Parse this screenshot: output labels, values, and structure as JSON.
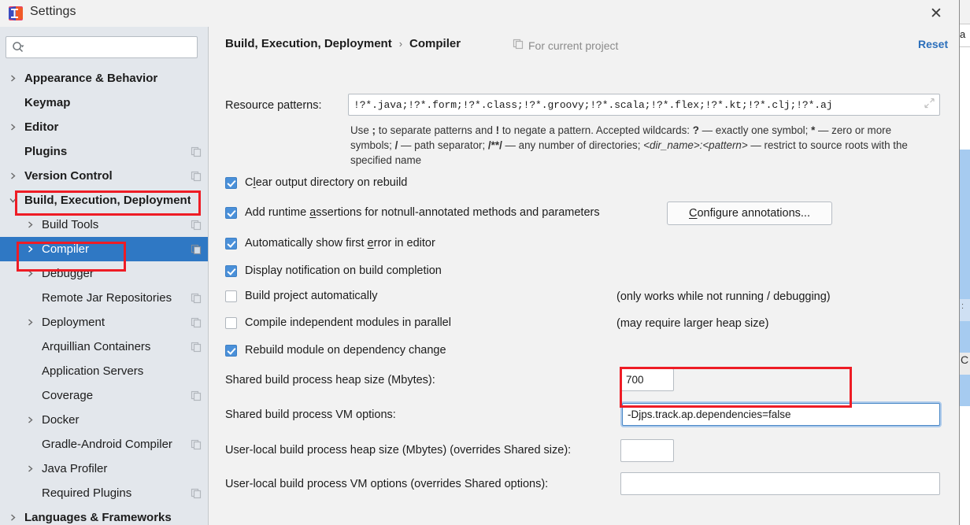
{
  "window": {
    "title": "Settings",
    "app_icon": "intellij-idea-icon",
    "close_label": "✕"
  },
  "sidebar": {
    "search": {
      "placeholder": "",
      "value": "",
      "icon": "search-icon",
      "dropdown_icon": "chevron-down-icon"
    },
    "items": [
      {
        "label": "Appearance & Behavior",
        "level": 0,
        "arrow": "collapsed",
        "copy": false,
        "selected": false
      },
      {
        "label": "Keymap",
        "level": 0,
        "arrow": "none",
        "copy": false,
        "selected": false
      },
      {
        "label": "Editor",
        "level": 0,
        "arrow": "collapsed",
        "copy": false,
        "selected": false
      },
      {
        "label": "Plugins",
        "level": 0,
        "arrow": "none",
        "copy": true,
        "selected": false
      },
      {
        "label": "Version Control",
        "level": 0,
        "arrow": "collapsed",
        "copy": true,
        "selected": false
      },
      {
        "label": "Build, Execution, Deployment",
        "level": 0,
        "arrow": "expanded",
        "copy": false,
        "selected": false
      },
      {
        "label": "Build Tools",
        "level": 1,
        "arrow": "collapsed",
        "copy": true,
        "selected": false
      },
      {
        "label": "Compiler",
        "level": 1,
        "arrow": "collapsed",
        "copy": true,
        "selected": true
      },
      {
        "label": "Debugger",
        "level": 1,
        "arrow": "collapsed",
        "copy": false,
        "selected": false
      },
      {
        "label": "Remote Jar Repositories",
        "level": 1,
        "arrow": "none",
        "copy": true,
        "selected": false
      },
      {
        "label": "Deployment",
        "level": 1,
        "arrow": "collapsed",
        "copy": true,
        "selected": false
      },
      {
        "label": "Arquillian Containers",
        "level": 1,
        "arrow": "none",
        "copy": true,
        "selected": false
      },
      {
        "label": "Application Servers",
        "level": 1,
        "arrow": "none",
        "copy": false,
        "selected": false
      },
      {
        "label": "Coverage",
        "level": 1,
        "arrow": "none",
        "copy": true,
        "selected": false
      },
      {
        "label": "Docker",
        "level": 1,
        "arrow": "collapsed",
        "copy": false,
        "selected": false
      },
      {
        "label": "Gradle-Android Compiler",
        "level": 1,
        "arrow": "none",
        "copy": true,
        "selected": false
      },
      {
        "label": "Java Profiler",
        "level": 1,
        "arrow": "collapsed",
        "copy": false,
        "selected": false
      },
      {
        "label": "Required Plugins",
        "level": 1,
        "arrow": "none",
        "copy": true,
        "selected": false
      },
      {
        "label": "Languages & Frameworks",
        "level": 0,
        "arrow": "collapsed",
        "copy": false,
        "selected": false
      }
    ]
  },
  "header": {
    "breadcrumb_parent": "Build, Execution, Deployment",
    "breadcrumb_separator": "›",
    "breadcrumb_current": "Compiler",
    "for_current_project": "For current project",
    "for_current_project_icon": "copy-project-icon",
    "reset_label": "Reset"
  },
  "form": {
    "resource_patterns_label": "Resource patterns:",
    "resource_patterns_value": "!?*.java;!?*.form;!?*.class;!?*.groovy;!?*.scala;!?*.flex;!?*.kt;!?*.clj;!?*.aj",
    "resource_patterns_expand_icon": "expand-arrows-icon",
    "help_text": {
      "p1": "Use ",
      "b1": ";",
      "p2": " to separate patterns and ",
      "b2": "!",
      "p3": " to negate a pattern. Accepted wildcards: ",
      "b3": "?",
      "p4": " — exactly one symbol; ",
      "b4": "*",
      "p5": " — zero or more symbols; ",
      "b5": "/",
      "p6": " — path separator; ",
      "b6": "/**/",
      "p7": " — any number of directories; ",
      "i1": "<dir_name>:<pattern>",
      "p8": " — restrict to source roots with the specified name"
    },
    "checkboxes": [
      {
        "id": "clear-output-directory-on-rebuild",
        "pre": "C",
        "mn": "l",
        "post": "ear output directory on rebuild",
        "checked": true,
        "note": ""
      },
      {
        "id": "add-runtime-assertions",
        "pre": "Add runtime ",
        "mn": "a",
        "post": "ssertions for notnull-annotated methods and parameters",
        "checked": true,
        "note": ""
      },
      {
        "id": "automatically-show-first-error",
        "pre": "Automatically show first ",
        "mn": "e",
        "post": "rror in editor",
        "checked": true,
        "note": ""
      },
      {
        "id": "display-notification-on-build-completion",
        "pre": "Display notification on build completion",
        "mn": "",
        "post": "",
        "checked": true,
        "note": ""
      },
      {
        "id": "build-project-automatically",
        "pre": "Build project automatically",
        "mn": "",
        "post": "",
        "checked": false,
        "note": "(only works while not running / debugging)"
      },
      {
        "id": "compile-independent-modules-in-parallel",
        "pre": "Compile independent modules in parallel",
        "mn": "",
        "post": "",
        "checked": false,
        "note": "(may require larger heap size)"
      },
      {
        "id": "rebuild-module-on-dependency-change",
        "pre": "Rebuild module on dependency change",
        "mn": "",
        "post": "",
        "checked": true,
        "note": ""
      }
    ],
    "configure_annotations_button": {
      "pre": "C",
      "mn": "C",
      "post": "onfigure annotations...",
      "label": "Configure annotations..."
    },
    "shared_heap_label": "Shared build process heap size (Mbytes):",
    "shared_heap_value": "700",
    "shared_vm_label": "Shared build process VM options:",
    "shared_vm_value": "-Djps.track.ap.dependencies=false",
    "userlocal_heap_label": "User-local build process heap size (Mbytes) (overrides Shared size):",
    "userlocal_heap_value": "",
    "userlocal_vm_label": "User-local build process VM options (overrides Shared options):",
    "userlocal_vm_value": ""
  },
  "annotations": {
    "highlight_color": "#ee1c25",
    "boxes": [
      "build-execution-deployment-tree-item",
      "compiler-tree-item",
      "shared-vm-options-field"
    ]
  },
  "background": {
    "tab_text": "a",
    "code_char": "C"
  },
  "colors": {
    "selection_blue": "#2f78c4",
    "checkbox_blue": "#4a90d9",
    "link_blue": "#2b6fbb",
    "sidebar_bg": "#e3e7ec",
    "content_bg": "#f2f2f2"
  }
}
